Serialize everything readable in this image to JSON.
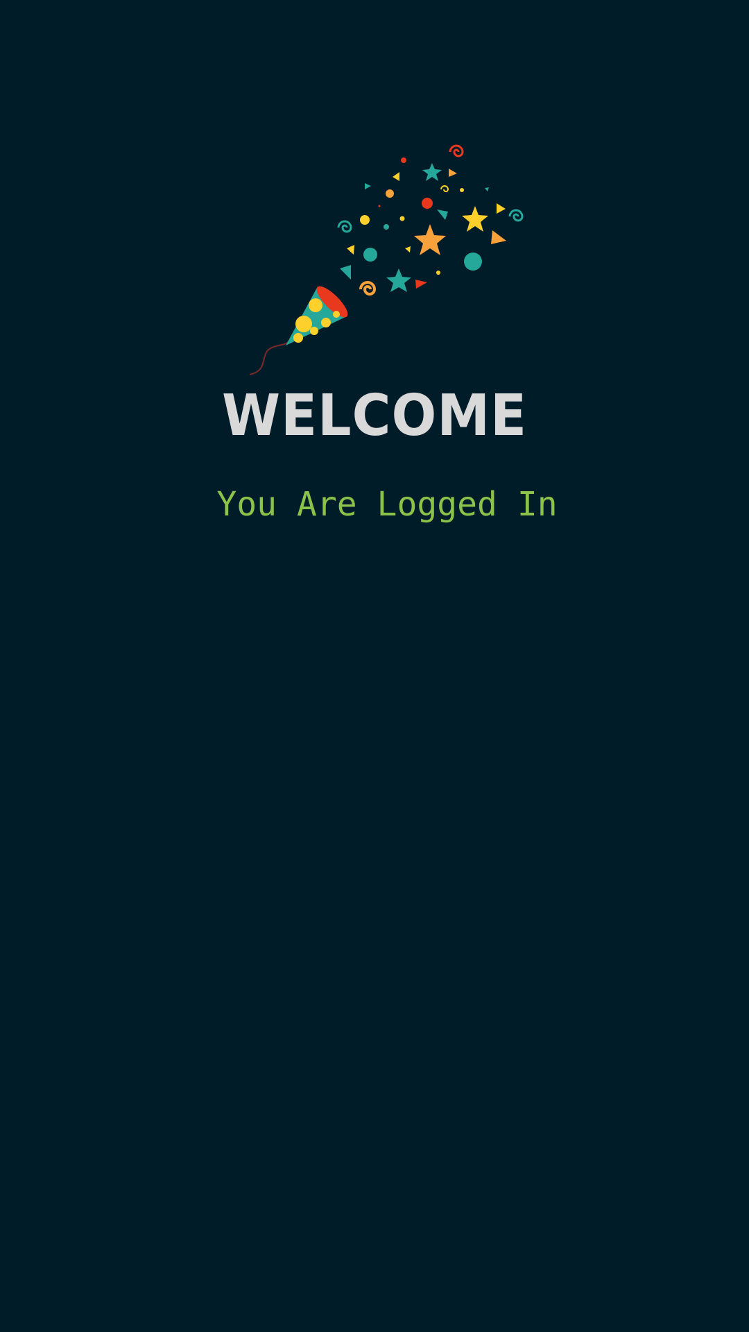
{
  "screen": {
    "illustration": "party-popper-icon",
    "title": "WELCOME",
    "subtitle": "You Are Logged In"
  },
  "colors": {
    "background": "#011c29",
    "title": "#d9d9d9",
    "subtitle": "#8bc34a",
    "confetti_teal": "#25a89a",
    "confetti_yellow": "#fdd02b",
    "confetti_orange": "#f9a13a",
    "confetti_red": "#e8391f"
  }
}
